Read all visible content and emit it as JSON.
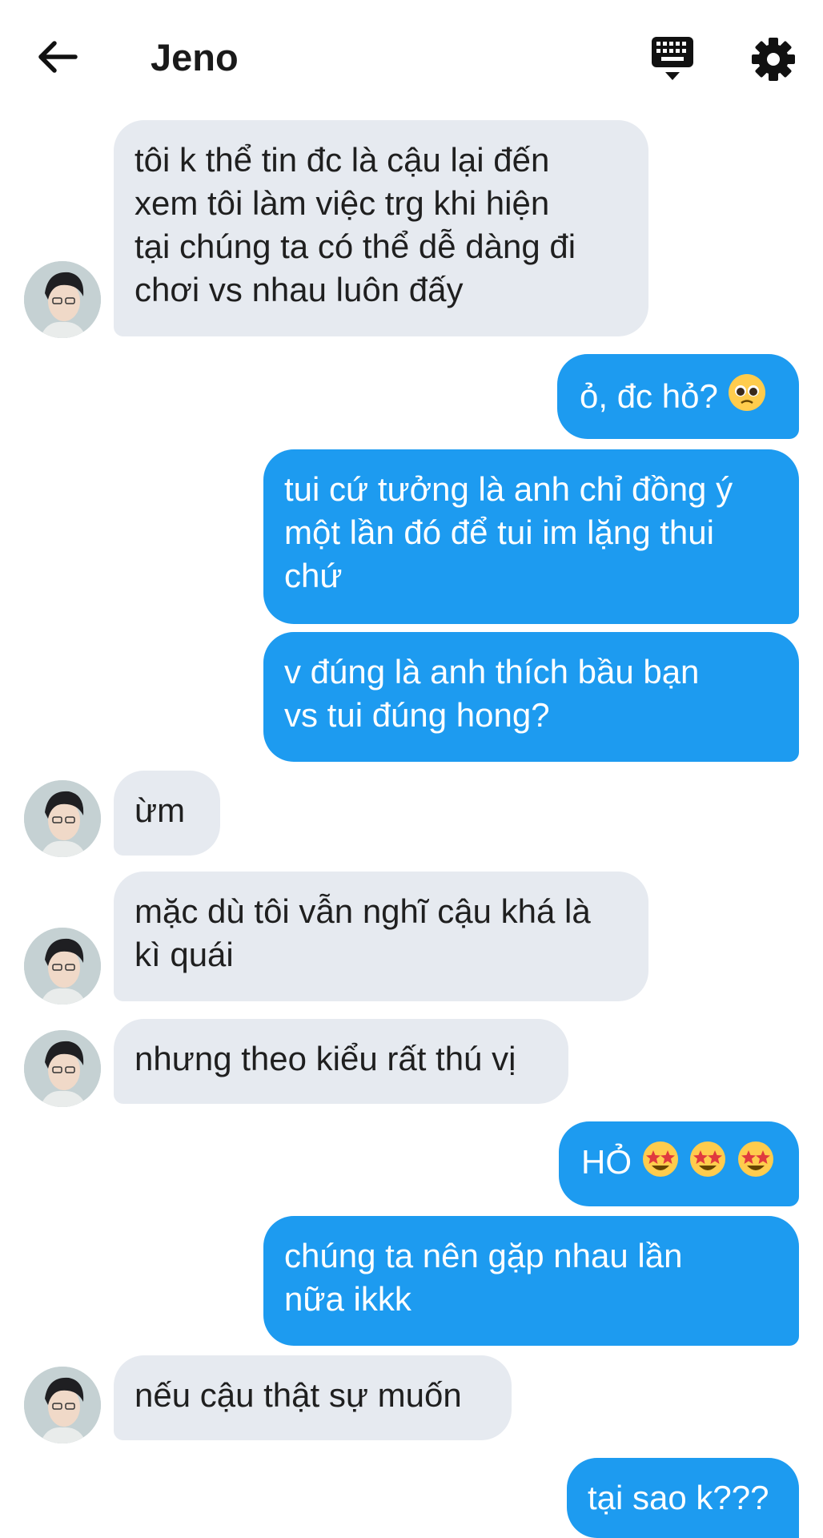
{
  "header": {
    "title": "Jeno",
    "back_icon": "arrow-left-icon",
    "keyboard_icon": "keyboard-icon",
    "settings_icon": "gear-icon"
  },
  "colors": {
    "incoming_bubble": "#e6eaf0",
    "outgoing_bubble": "#1d9bf0",
    "incoming_text": "#1f1f1f",
    "outgoing_text": "#ffffff"
  },
  "messages": [
    {
      "direction": "in",
      "lines": [
        "tôi k thể tin đc là cậu lại đến",
        "xem tôi làm việc trg khi hiện",
        "tại chúng ta có thể dễ dàng đi",
        "chơi vs nhau luôn đấy"
      ]
    },
    {
      "direction": "out",
      "lines": [
        "ỏ, đc hỏ?"
      ],
      "emoji": "pleading-face"
    },
    {
      "direction": "out",
      "lines": [
        "tui cứ tưởng là anh chỉ đồng ý",
        "một lần đó để tui im lặng thui",
        "chứ"
      ]
    },
    {
      "direction": "out",
      "lines": [
        "v đúng là anh thích bầu bạn",
        "vs tui đúng hong?"
      ]
    },
    {
      "direction": "in",
      "lines": [
        "ừm"
      ]
    },
    {
      "direction": "in",
      "lines": [
        "mặc dù tôi vẫn nghĩ cậu khá là",
        "kì quái"
      ]
    },
    {
      "direction": "in",
      "lines": [
        "nhưng theo kiểu rất thú vị"
      ]
    },
    {
      "direction": "out",
      "lines": [
        "HỎ"
      ],
      "emoji": "star-struck x3"
    },
    {
      "direction": "out",
      "lines": [
        "chúng ta nên gặp nhau lần",
        "nữa ikkk"
      ]
    },
    {
      "direction": "in",
      "lines": [
        "nếu cậu thật sự muốn"
      ]
    },
    {
      "direction": "out",
      "lines": [
        "tại sao k???"
      ]
    }
  ]
}
